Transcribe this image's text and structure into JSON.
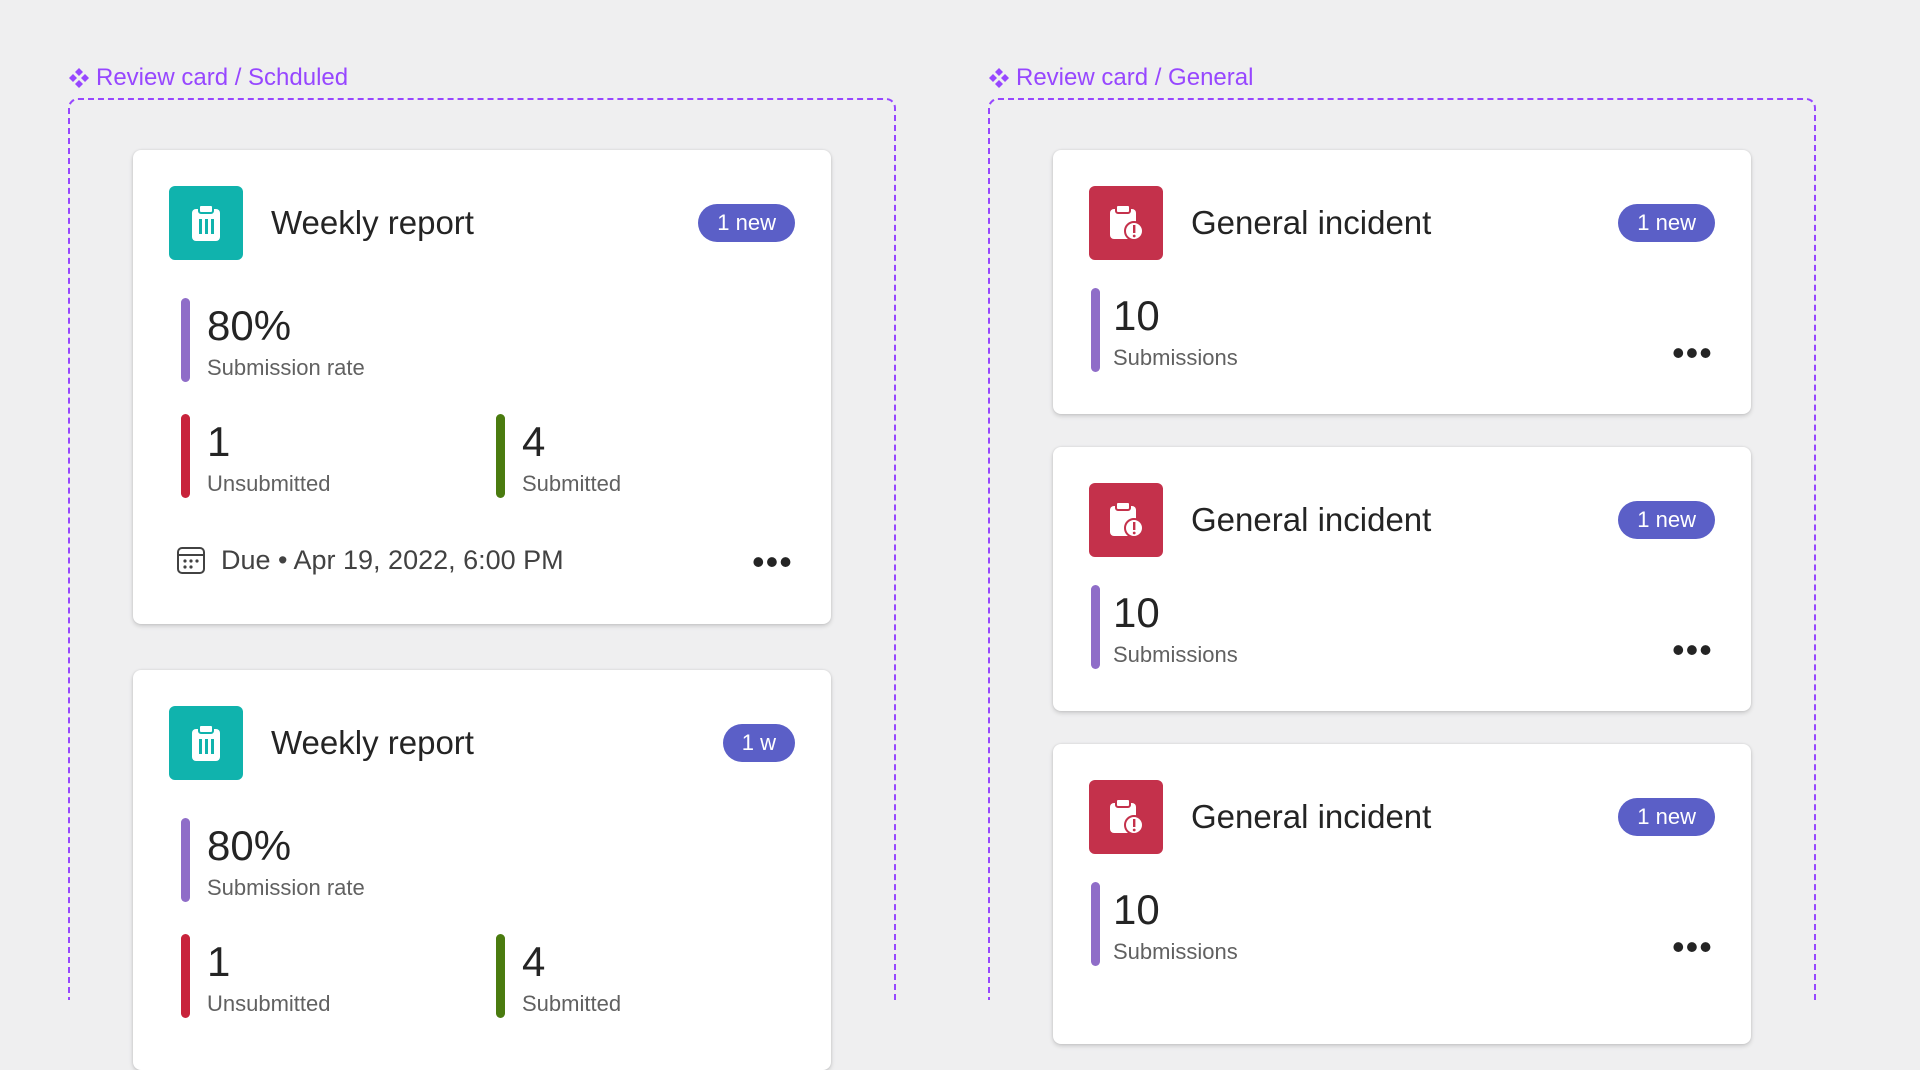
{
  "colors": {
    "component_purple": "#9747ff",
    "background": "#efeff0",
    "teal_icon": "#10b3ad",
    "red_icon": "#c4314b",
    "badge": "#5b5fc7",
    "bar_rate": "#8f6dc8",
    "bar_unsubmitted": "#c8233b",
    "bar_submitted": "#4a7b0f",
    "bar_submissions": "#8f6dc8"
  },
  "scheduled": {
    "label": "Review card / Schduled",
    "cards": [
      {
        "title": "Weekly report",
        "badge": "1 new",
        "icon": "clipboard-icon",
        "rate_value": "80%",
        "rate_label": "Submission rate",
        "unsubmitted_value": "1",
        "unsubmitted_label": "Unsubmitted",
        "submitted_value": "4",
        "submitted_label": "Submitted",
        "due": "Due • Apr 19, 2022, 6:00 PM",
        "more": "•••"
      },
      {
        "title": "Weekly report",
        "badge": "1 w",
        "icon": "clipboard-icon",
        "rate_value": "80%",
        "rate_label": "Submission rate",
        "unsubmitted_value": "1",
        "unsubmitted_label": "Unsubmitted",
        "submitted_value": "4",
        "submitted_label": "Submitted"
      }
    ]
  },
  "general": {
    "label": "Review card / General",
    "cards": [
      {
        "title": "General incident",
        "badge": "1 new",
        "icon": "clipboard-alert-icon",
        "value": "10",
        "label": "Submissions",
        "more": "•••"
      },
      {
        "title": "General incident",
        "badge": "1 new",
        "icon": "clipboard-alert-icon",
        "value": "10",
        "label": "Submissions",
        "more": "•••"
      },
      {
        "title": "General incident",
        "badge": "1 new",
        "icon": "clipboard-alert-icon",
        "value": "10",
        "label": "Submissions",
        "more": "•••"
      }
    ]
  }
}
